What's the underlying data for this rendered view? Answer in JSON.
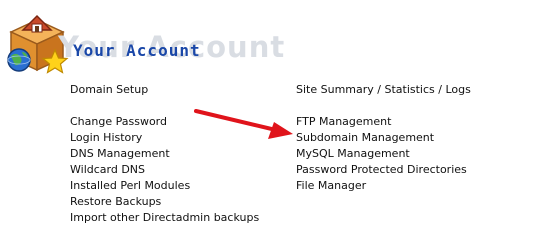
{
  "header": {
    "title": "Your Account",
    "title_ghost": "Your Account",
    "icon": "house-globe-star-icon"
  },
  "left_column": {
    "domain_setup": "Domain Setup",
    "change_password": "Change Password",
    "login_history": "Login History",
    "dns_management": "DNS Management",
    "wildcard_dns": "Wildcard DNS",
    "installed_perl_modules": "Installed Perl Modules",
    "restore_backups": "Restore Backups",
    "import_backups": "Import other Directadmin backups"
  },
  "right_column": {
    "site_summary": "Site Summary / Statistics / Logs",
    "ftp_management": "FTP Management",
    "subdomain_management": "Subdomain Management",
    "mysql_management": "MySQL Management",
    "password_protected_directories": "Password Protected Directories",
    "file_manager": "File Manager"
  },
  "annotation": {
    "icon": "red-arrow-icon",
    "color": "#e0141b"
  },
  "colors": {
    "title": "#1a47a8",
    "title_ghost": "#d9dde3",
    "text": "#111111"
  }
}
